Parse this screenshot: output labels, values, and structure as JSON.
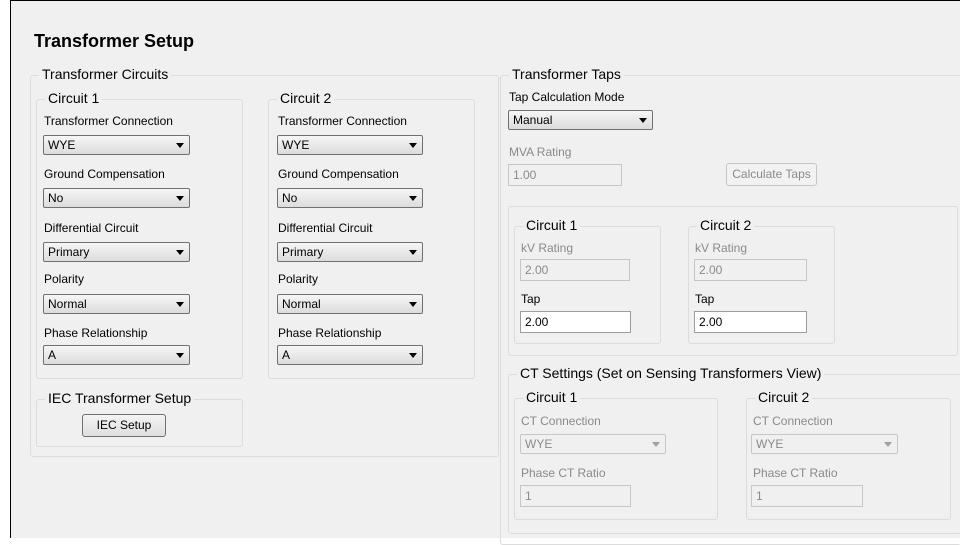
{
  "page": {
    "title": "Transformer Setup"
  },
  "circuits_group": {
    "title": "Transformer Circuits",
    "circuit1": {
      "title": "Circuit 1",
      "transformer_connection": {
        "label": "Transformer Connection",
        "value": "WYE"
      },
      "ground_compensation": {
        "label": "Ground Compensation",
        "value": "No"
      },
      "differential_circuit": {
        "label": "Differential Circuit",
        "value": "Primary"
      },
      "polarity": {
        "label": "Polarity",
        "value": "Normal"
      },
      "phase_relationship": {
        "label": "Phase Relationship",
        "value": "A"
      }
    },
    "circuit2": {
      "title": "Circuit 2",
      "transformer_connection": {
        "label": "Transformer Connection",
        "value": "WYE"
      },
      "ground_compensation": {
        "label": "Ground Compensation",
        "value": "No"
      },
      "differential_circuit": {
        "label": "Differential Circuit",
        "value": "Primary"
      },
      "polarity": {
        "label": "Polarity",
        "value": "Normal"
      },
      "phase_relationship": {
        "label": "Phase Relationship",
        "value": "A"
      }
    },
    "iec": {
      "title": "IEC Transformer Setup",
      "button": "IEC Setup"
    }
  },
  "taps_group": {
    "title": "Transformer Taps",
    "tap_calculation_mode": {
      "label": "Tap Calculation Mode",
      "value": "Manual"
    },
    "mva_rating": {
      "label": "MVA Rating",
      "value": "1.00"
    },
    "calculate_button": "Calculate Taps",
    "circuit1": {
      "title": "Circuit 1",
      "kv_label": "kV Rating",
      "kv_value": "2.00",
      "tap_label": "Tap",
      "tap_value": "2.00"
    },
    "circuit2": {
      "title": "Circuit 2",
      "kv_label": "kV Rating",
      "kv_value": "2.00",
      "tap_label": "Tap",
      "tap_value": "2.00"
    }
  },
  "ct_group": {
    "title": "CT Settings (Set on Sensing Transformers View)",
    "circuit1": {
      "title": "Circuit 1",
      "ct_connection_label": "CT Connection",
      "ct_connection_value": "WYE",
      "phase_ct_ratio_label": "Phase CT Ratio",
      "phase_ct_ratio_value": "1"
    },
    "circuit2": {
      "title": "Circuit 2",
      "ct_connection_label": "CT Connection",
      "ct_connection_value": "WYE",
      "phase_ct_ratio_label": "Phase CT Ratio",
      "phase_ct_ratio_value": "1"
    }
  },
  "colors": {
    "panel": "#f0f0f0",
    "border": "#dcdcdc",
    "disabled_text": "#8a8a8a"
  },
  "icons": {
    "dropdown": "chevron-down-icon"
  }
}
